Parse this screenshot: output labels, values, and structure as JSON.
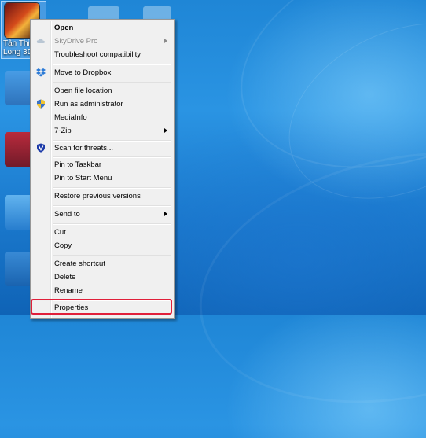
{
  "desktop": {
    "selected_icon_label_line1": "Tân Thiê",
    "selected_icon_label_line2": "Long 3D"
  },
  "context_menu": {
    "items": [
      {
        "label": "Open",
        "bold": true
      },
      {
        "label": "SkyDrive Pro",
        "disabled": true,
        "submenu": true,
        "icon": "cloud-icon"
      },
      {
        "label": "Troubleshoot compatibility"
      },
      {
        "label": "Move to Dropbox",
        "icon": "dropbox-icon"
      },
      {
        "label": "Open file location"
      },
      {
        "label": "Run as administrator",
        "icon": "uac-shield-icon"
      },
      {
        "label": "MediaInfo"
      },
      {
        "label": "7-Zip",
        "submenu": true
      },
      {
        "label": "Scan for threats...",
        "icon": "antivirus-shield-icon"
      },
      {
        "label": "Pin to Taskbar"
      },
      {
        "label": "Pin to Start Menu"
      },
      {
        "label": "Restore previous versions"
      },
      {
        "label": "Send to",
        "submenu": true
      },
      {
        "label": "Cut"
      },
      {
        "label": "Copy"
      },
      {
        "label": "Create shortcut"
      },
      {
        "label": "Delete"
      },
      {
        "label": "Rename"
      },
      {
        "label": "Properties",
        "highlighted": true
      }
    ]
  },
  "colors": {
    "highlight_border": "#e01f3a",
    "menu_background": "#f0f0f0",
    "disabled_text": "#8a8a8a"
  }
}
